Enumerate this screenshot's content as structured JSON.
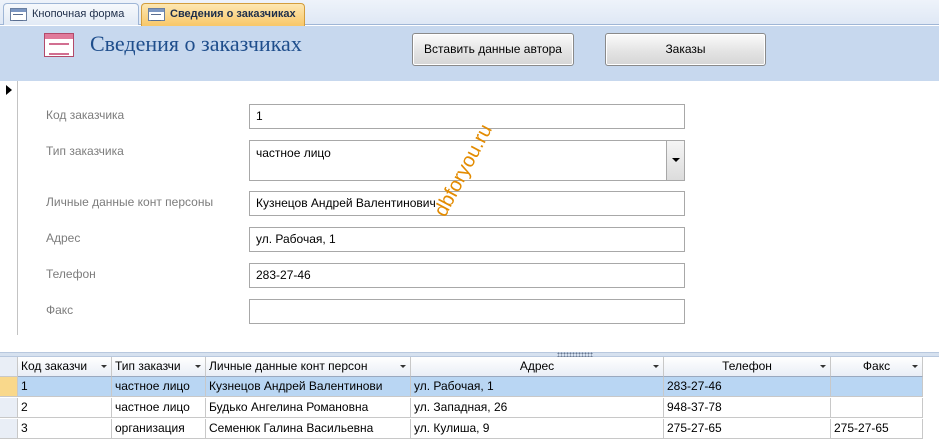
{
  "tabs": [
    {
      "label": "Кнопочная форма",
      "active": false,
      "icon": "form-icon"
    },
    {
      "label": "Сведения о заказчиках",
      "active": true,
      "icon": "form-icon"
    }
  ],
  "header": {
    "title": "Сведения о заказчиках",
    "icon": "form-icon",
    "buttons": {
      "insert_author": "Вставить данные автора",
      "orders": "Заказы"
    }
  },
  "form": {
    "fields": [
      {
        "label": "Код заказчика",
        "value": "1"
      },
      {
        "label": "Тип заказчика",
        "value": "частное лицо"
      },
      {
        "label": "Личные данные конт персоны",
        "value": "Кузнецов Андрей Валентинович"
      },
      {
        "label": "Адрес",
        "value": "ул. Рабочая, 1"
      },
      {
        "label": "Телефон",
        "value": "283-27-46"
      },
      {
        "label": "Факс",
        "value": ""
      }
    ]
  },
  "watermark": "dbforyou.ru",
  "table": {
    "columns": [
      "Код заказчи",
      "Тип заказчи",
      "Личные данные конт персон",
      "Адрес",
      "Телефон",
      "Факс"
    ],
    "rows": [
      [
        "1",
        "частное лицо",
        "Кузнецов Андрей Валентинови",
        "ул. Рабочая, 1",
        "283-27-46",
        ""
      ],
      [
        "2",
        "частное лицо",
        "Будько Ангелина Романовна",
        "ул. Западная, 26",
        "948-37-78",
        ""
      ],
      [
        "3",
        "организация",
        "Семенюк Галина Васильевна",
        "ул. Кулиша, 9",
        "275-27-65",
        "275-27-65"
      ]
    ],
    "selected_row": 0
  },
  "colors": {
    "header_bg": "#c7d8ee",
    "title_color": "#1f4e8c",
    "active_tab": "#f8c768",
    "selected_row": "#b9d6f3",
    "watermark": "#e38b00"
  }
}
